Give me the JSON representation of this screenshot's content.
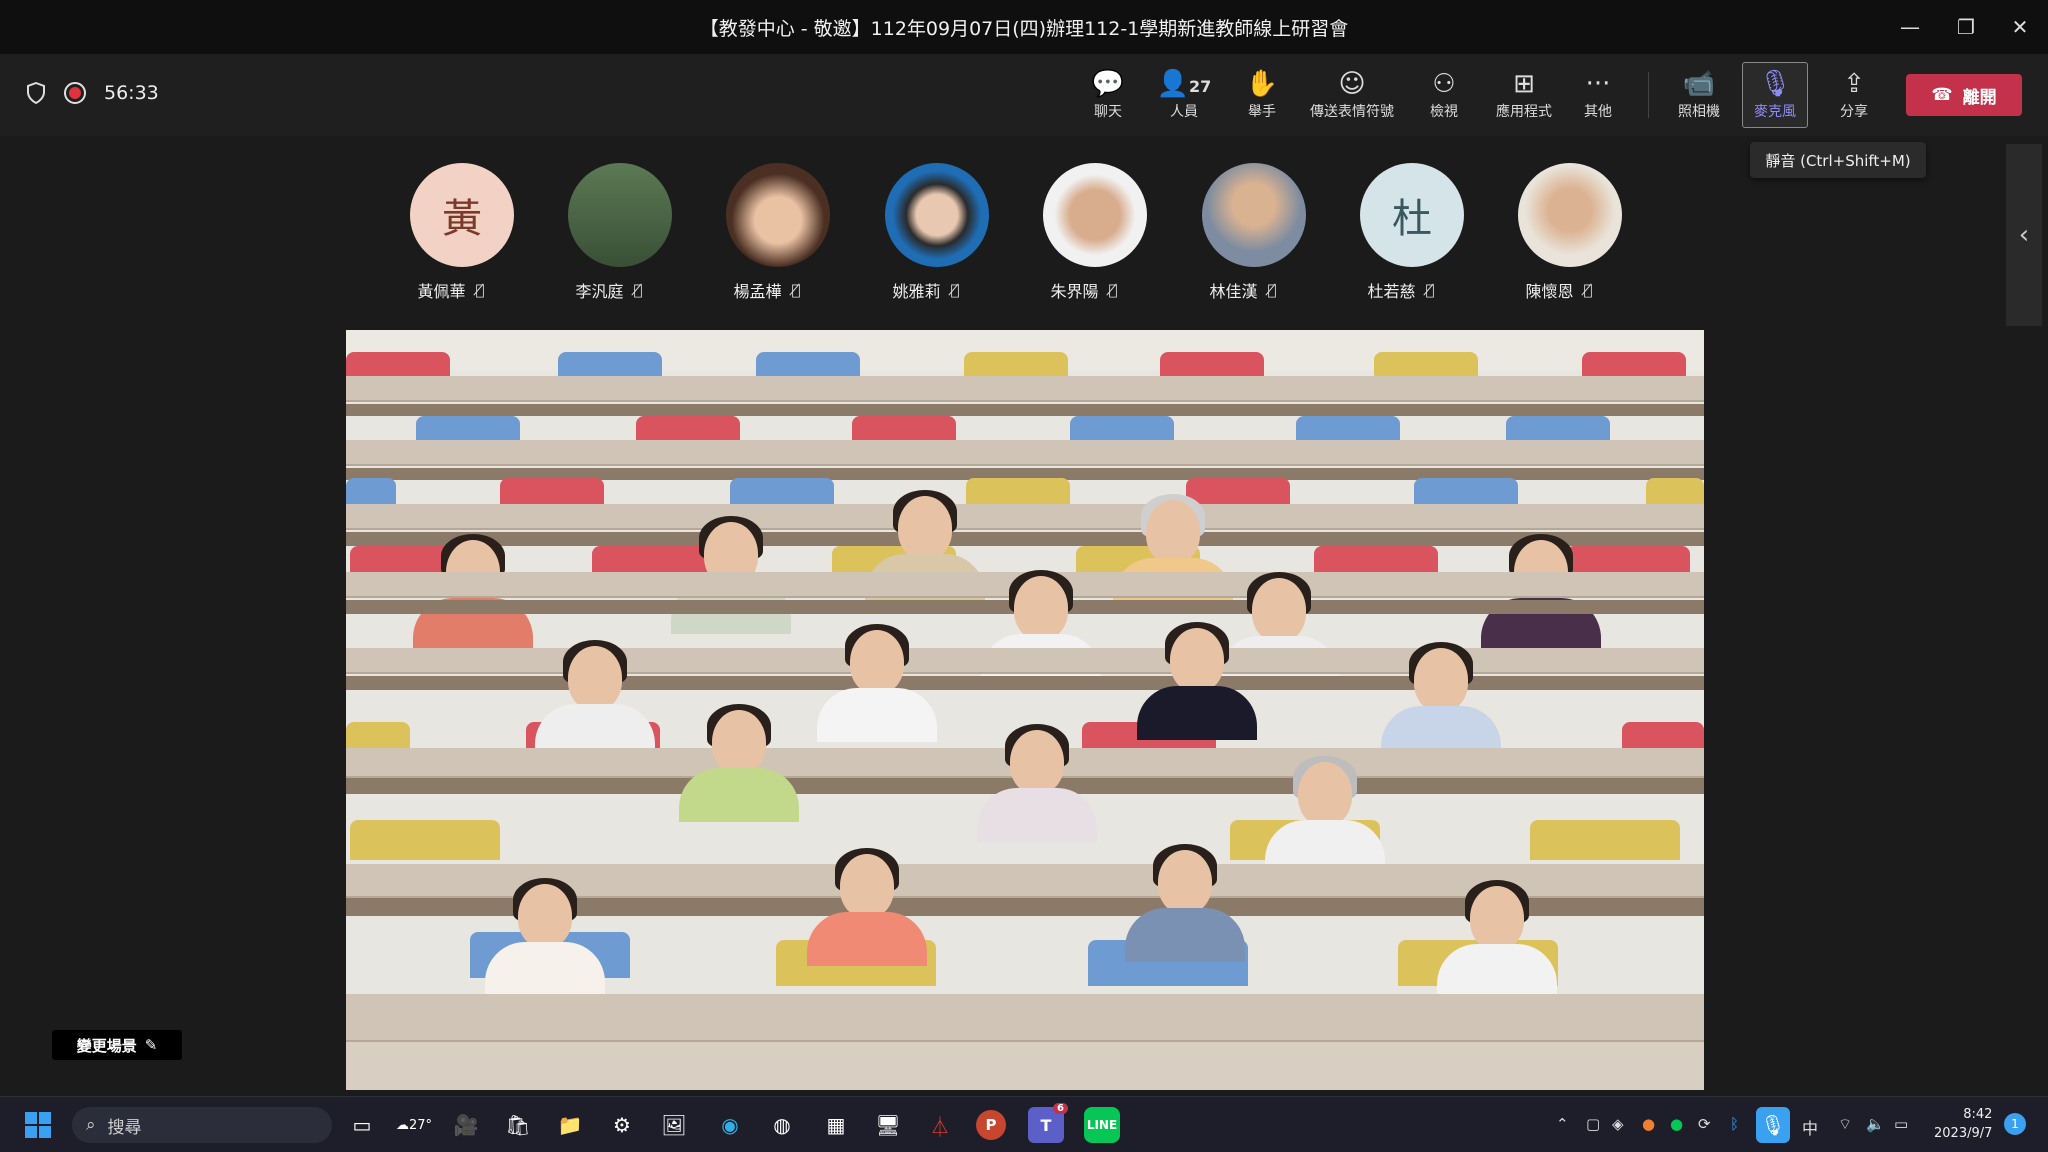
{
  "window": {
    "title": "【教發中心 - 敬邀】112年09月07日(四)辦理112-1學期新進教師線上研習會",
    "minimize": "—",
    "restore": "❐",
    "close": "✕"
  },
  "meeting": {
    "elapsed": "56:33",
    "toolbar": {
      "chat": "聊天",
      "people": "人員",
      "people_count": "27",
      "raise_hand": "舉手",
      "reactions": "傳送表情符號",
      "view": "檢視",
      "apps": "應用程式",
      "more": "其他",
      "camera": "照相機",
      "mic": "麥克風",
      "share": "分享",
      "leave": "離開"
    },
    "tooltip": "靜音 (Ctrl+Shift+M)",
    "participants": [
      {
        "name": "黃佩華",
        "initial": "黃"
      },
      {
        "name": "李汎庭"
      },
      {
        "name": "楊孟樺"
      },
      {
        "name": "姚雅莉"
      },
      {
        "name": "朱界陽"
      },
      {
        "name": "林佳漢"
      },
      {
        "name": "杜若慈",
        "initial": "杜"
      },
      {
        "name": "陳懷恩"
      }
    ],
    "change_scene": "變更場景"
  },
  "taskbar": {
    "search_placeholder": "搜尋",
    "weather": "27°",
    "teams_badge": "6",
    "ime": "中",
    "time": "8:42",
    "date": "2023/9/7",
    "notification_count": "1"
  },
  "colors": {
    "leave": "#c4314b",
    "active_accent": "#8b8cf4",
    "seat_red": "#d9545e",
    "seat_blue": "#6e9bd1",
    "seat_yellow": "#dcc25a"
  }
}
